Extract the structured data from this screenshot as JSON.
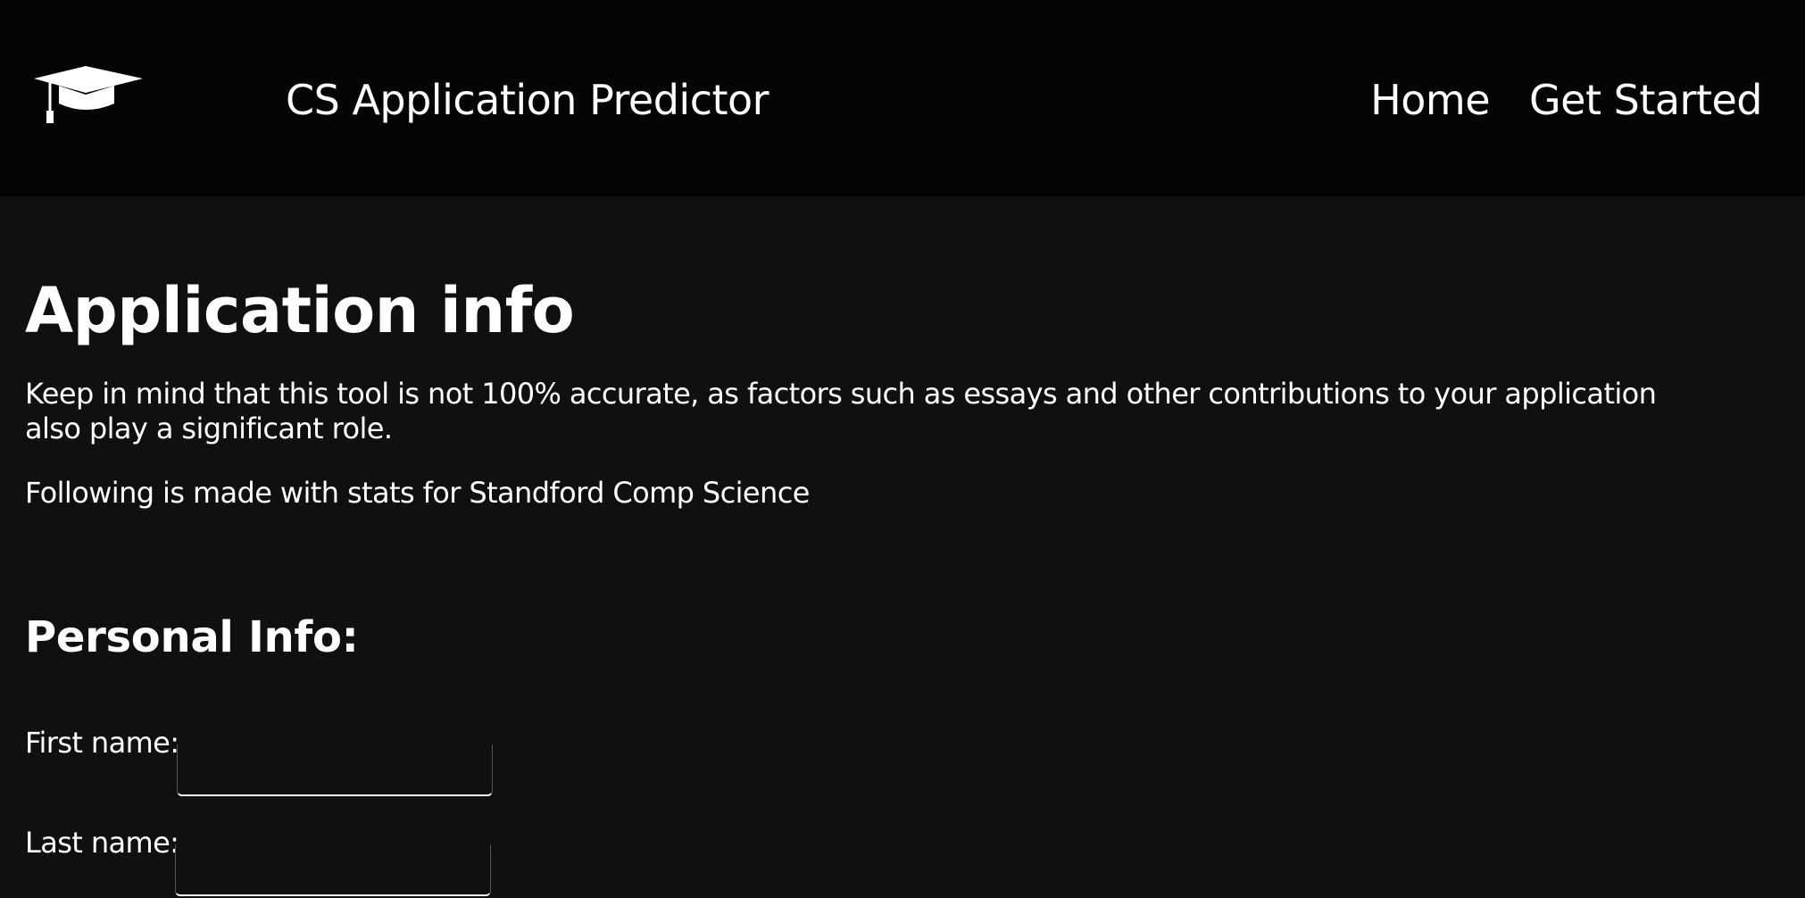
{
  "header": {
    "logo_icon": "graduation-cap-icon",
    "brand": "CS Application Predictor",
    "nav": [
      {
        "label": "Home"
      },
      {
        "label": "Get Started"
      }
    ]
  },
  "main": {
    "title": "Application info",
    "disclaimer": "Keep in mind that this tool is not 100% accurate, as factors such as essays and other contributions to your application also play a significant role.",
    "stats_note": "Following is made with stats for Standford Comp Science",
    "personal_section": {
      "title": "Personal Info:",
      "first_name_label": "First name:",
      "first_name_value": "",
      "last_name_label": "Last name:",
      "last_name_value": ""
    }
  },
  "colors": {
    "background": "#101010",
    "header_background": "#050505",
    "text": "#ffffff"
  }
}
